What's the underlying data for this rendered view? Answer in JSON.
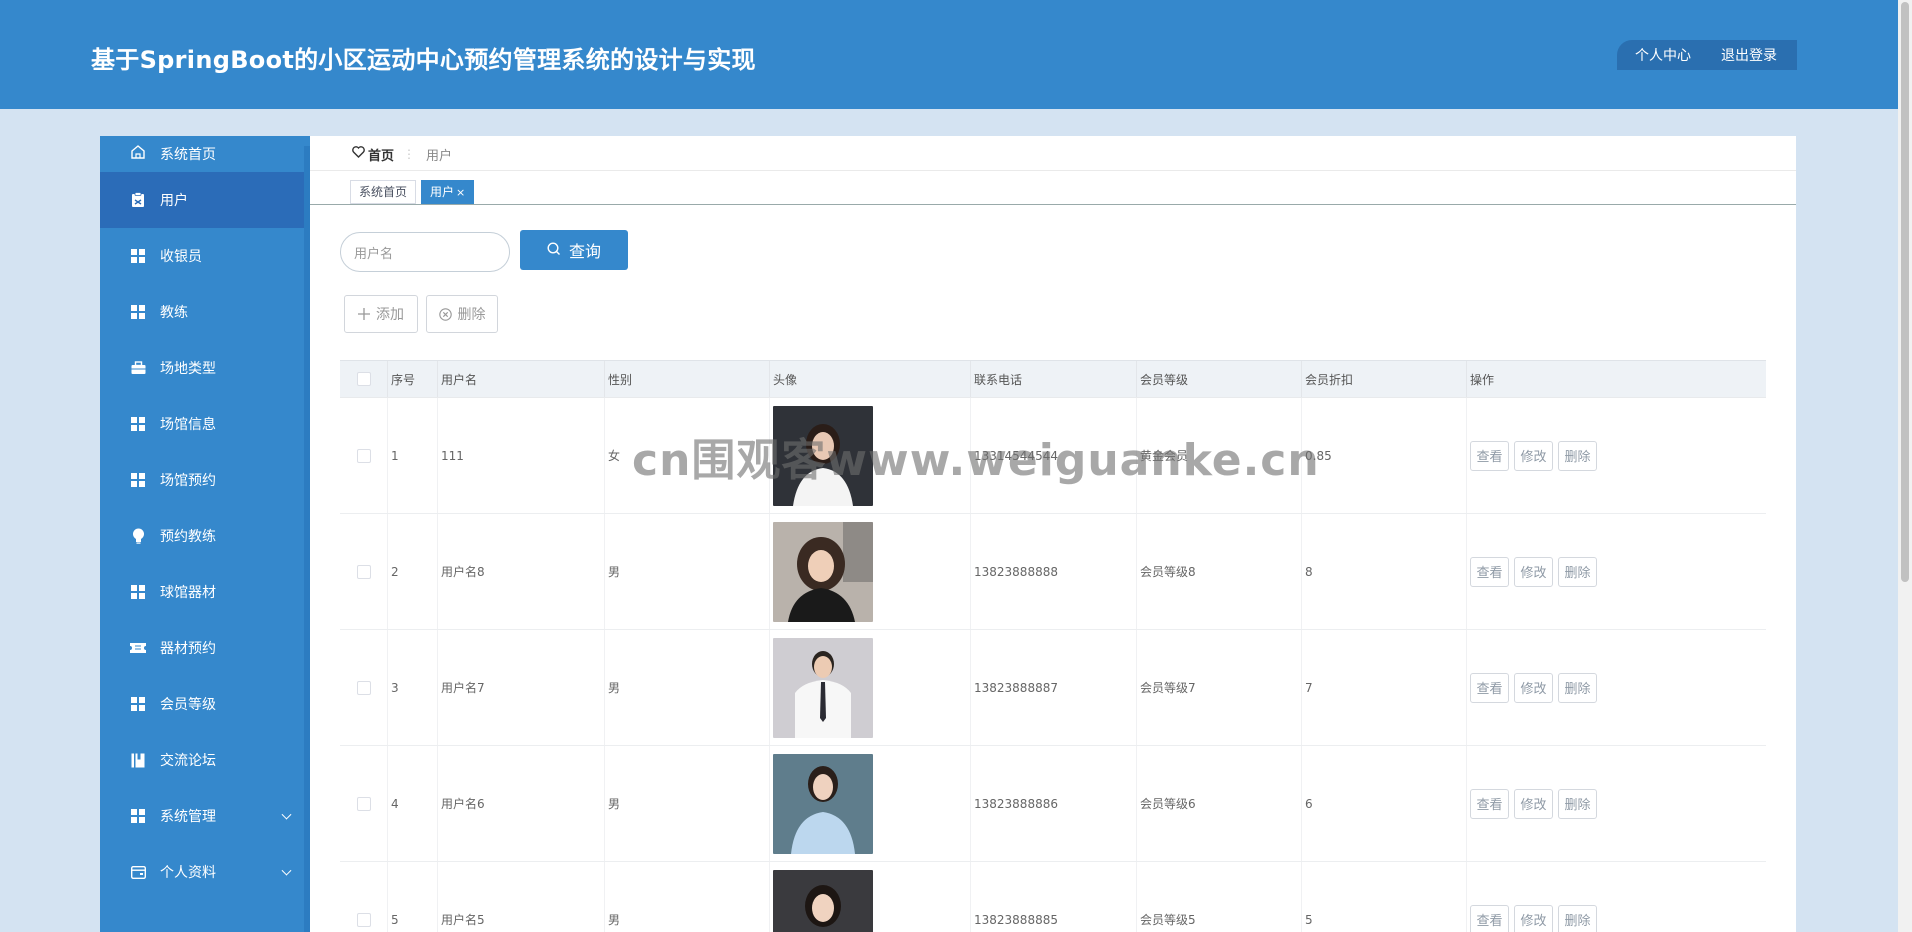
{
  "header": {
    "title": "基于SpringBoot的小区运动中心预约管理系统的设计与实现",
    "profile_label": "个人中心",
    "logout_label": "退出登录"
  },
  "sidebar": {
    "items": [
      {
        "label": "系统首页",
        "icon": "home-icon"
      },
      {
        "label": "用户",
        "icon": "user-clipboard-icon",
        "active": true
      },
      {
        "label": "收银员",
        "icon": "grid-icon"
      },
      {
        "label": "教练",
        "icon": "grid-icon"
      },
      {
        "label": "场地类型",
        "icon": "briefcase-icon"
      },
      {
        "label": "场馆信息",
        "icon": "grid-icon"
      },
      {
        "label": "场馆预约",
        "icon": "grid-icon"
      },
      {
        "label": "预约教练",
        "icon": "bulb-icon"
      },
      {
        "label": "球馆器材",
        "icon": "grid-icon"
      },
      {
        "label": "器材预约",
        "icon": "ticket-icon"
      },
      {
        "label": "会员等级",
        "icon": "grid-icon"
      },
      {
        "label": "交流论坛",
        "icon": "book-icon"
      },
      {
        "label": "系统管理",
        "icon": "grid-icon",
        "expandable": true
      },
      {
        "label": "个人资料",
        "icon": "wallet-icon",
        "expandable": true
      }
    ]
  },
  "breadcrumb": {
    "home": "首页",
    "separator": "⋮",
    "current": "用户"
  },
  "tabs": [
    {
      "label": "系统首页"
    },
    {
      "label": "用户",
      "active": true,
      "close": "×"
    }
  ],
  "search": {
    "placeholder": "用户名",
    "button_label": "查询"
  },
  "actions": {
    "add_label": "添加",
    "delete_label": "删除"
  },
  "table": {
    "headers": [
      "序号",
      "用户名",
      "性别",
      "头像",
      "联系电话",
      "会员等级",
      "会员折扣",
      "操作"
    ],
    "rows": [
      {
        "index": "1",
        "username": "111",
        "gender": "女",
        "phone": "13314544544",
        "level": "黄金会员",
        "discount": "0.85"
      },
      {
        "index": "2",
        "username": "用户名8",
        "gender": "男",
        "phone": "13823888888",
        "level": "会员等级8",
        "discount": "8"
      },
      {
        "index": "3",
        "username": "用户名7",
        "gender": "男",
        "phone": "13823888887",
        "level": "会员等级7",
        "discount": "7"
      },
      {
        "index": "4",
        "username": "用户名6",
        "gender": "男",
        "phone": "13823888886",
        "level": "会员等级6",
        "discount": "6"
      },
      {
        "index": "5",
        "username": "用户名5",
        "gender": "男",
        "phone": "13823888885",
        "level": "会员等级5",
        "discount": "5"
      }
    ],
    "row_actions": {
      "view": "查看",
      "edit": "修改",
      "delete": "删除"
    }
  },
  "watermark": "cn围观客www.weiguanke.cn",
  "colors": {
    "primary": "#3588cc",
    "active_menu": "#2b6cb8",
    "page_bg": "#d4e3f2"
  }
}
